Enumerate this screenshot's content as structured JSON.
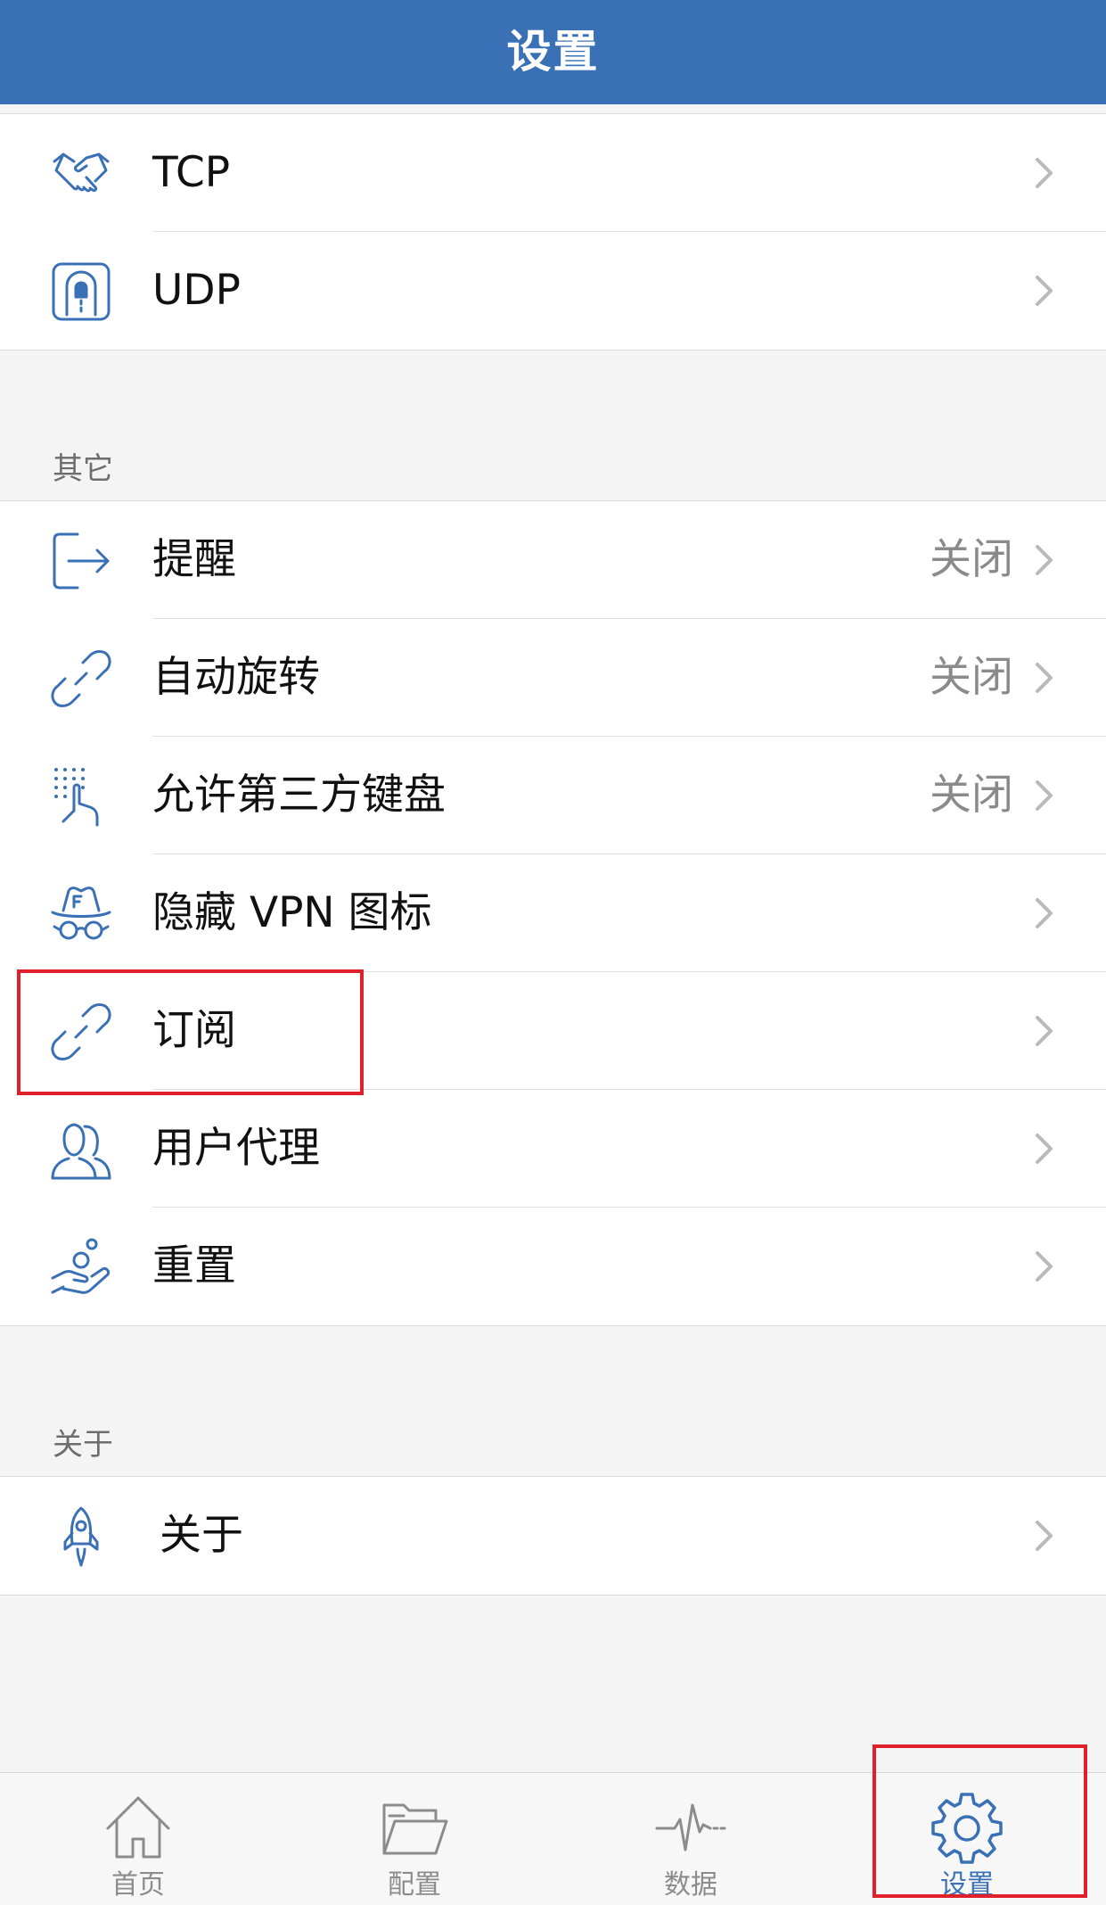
{
  "header": {
    "title": "设置"
  },
  "groups": {
    "network": {
      "items": [
        {
          "label": "TCP",
          "icon": "handshake-icon"
        },
        {
          "label": "UDP",
          "icon": "tunnel-icon"
        }
      ]
    },
    "other": {
      "header": "其它",
      "items": [
        {
          "label": "提醒",
          "value": "关闭",
          "icon": "sign-out-icon"
        },
        {
          "label": "自动旋转",
          "value": "关闭",
          "icon": "link-icon"
        },
        {
          "label": "允许第三方键盘",
          "value": "关闭",
          "icon": "keypad-touch-icon"
        },
        {
          "label": "隐藏 VPN 图标",
          "icon": "incognito-icon"
        },
        {
          "label": "订阅",
          "icon": "link-icon"
        },
        {
          "label": "用户代理",
          "icon": "users-icon"
        },
        {
          "label": "重置",
          "icon": "hand-coin-icon"
        }
      ]
    },
    "about": {
      "header": "关于",
      "items": [
        {
          "label": "关于",
          "icon": "rocket-icon"
        }
      ]
    }
  },
  "tabbar": {
    "tabs": [
      {
        "label": "首页",
        "icon": "home-icon"
      },
      {
        "label": "配置",
        "icon": "folder-icon"
      },
      {
        "label": "数据",
        "icon": "pulse-icon"
      },
      {
        "label": "设置",
        "icon": "gear-icon",
        "active": true
      }
    ]
  },
  "colors": {
    "accent": "#3a70b5",
    "annotation": "#e0202a"
  }
}
